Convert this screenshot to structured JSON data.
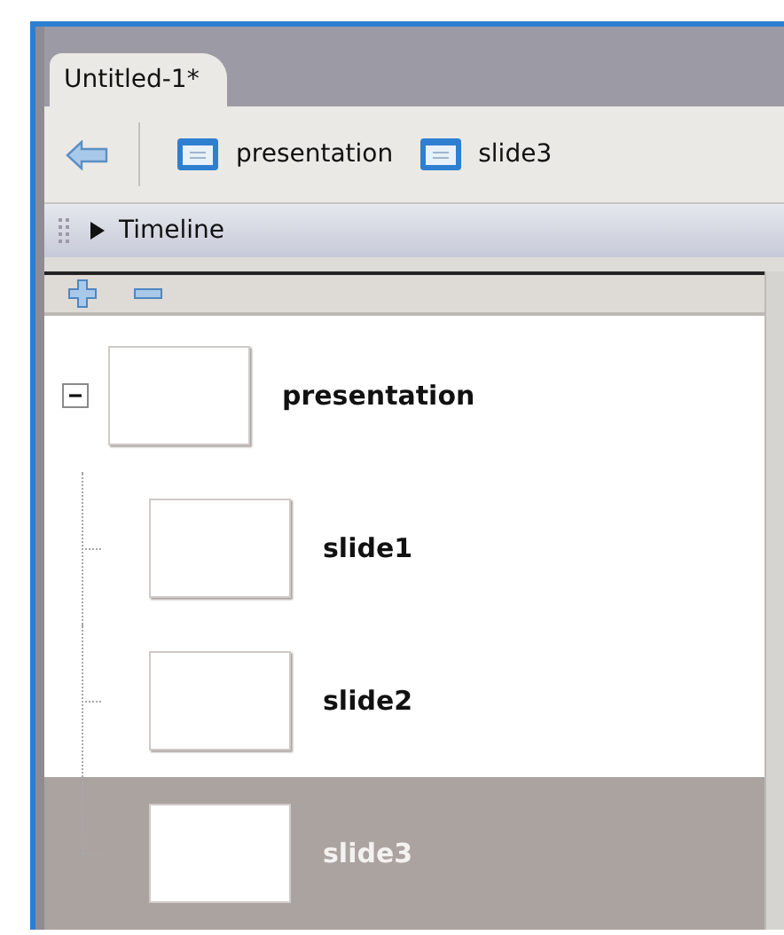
{
  "document_tab": {
    "label": "Untitled-1*",
    "selected": true
  },
  "breadcrumbs": [
    {
      "label": "presentation"
    },
    {
      "label": "slide3"
    }
  ],
  "timeline": {
    "label": "Timeline",
    "expanded": false
  },
  "tree": [
    {
      "label": "presentation",
      "expanded": true,
      "selected": false,
      "children": [
        {
          "label": "slide1",
          "selected": false
        },
        {
          "label": "slide2",
          "selected": false
        },
        {
          "label": "slide3",
          "selected": true
        }
      ]
    }
  ]
}
